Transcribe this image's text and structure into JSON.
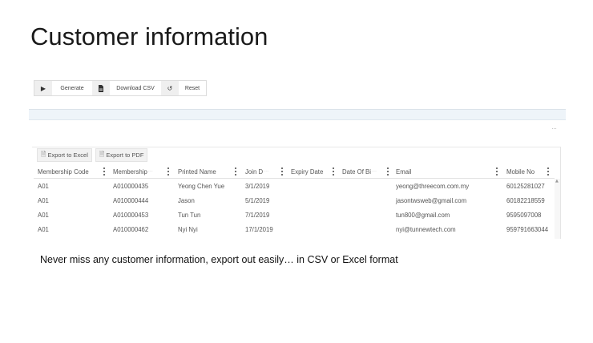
{
  "slide": {
    "title": "Customer information",
    "caption": "Never miss any customer information, export out easily… in CSV or Excel format"
  },
  "toolbar": {
    "generate_label": "Generate",
    "download_csv_label": "Download CSV",
    "reset_label": "Reset",
    "icons": [
      "play-icon",
      "document-icon",
      "refresh-icon"
    ]
  },
  "panel": {
    "more_label": "…"
  },
  "grid": {
    "export_excel_label": "Export to Excel",
    "export_pdf_label": "Export to PDF",
    "columns": [
      "Membership Code",
      "Membership",
      "Printed Name",
      "Join D",
      "Expiry Date",
      "Date Of Bi",
      "Email",
      "Mobile No"
    ],
    "rows": [
      [
        "A01",
        "A010000435",
        "Yeong Chen Yue",
        "3/1/2019",
        "",
        "",
        "yeong@threecom.com.my",
        "60125281027"
      ],
      [
        "A01",
        "A010000444",
        "Jason",
        "5/1/2019",
        "",
        "",
        "jasontwsweb@gmail.com",
        "60182218559"
      ],
      [
        "A01",
        "A010000453",
        "Tun Tun",
        "7/1/2019",
        "",
        "",
        "tun800@gmail.com",
        "9595097008"
      ],
      [
        "A01",
        "A010000462",
        "Nyi Nyi",
        "17/1/2019",
        "",
        "",
        "nyi@tunnewtech.com",
        "959791663044"
      ]
    ]
  }
}
